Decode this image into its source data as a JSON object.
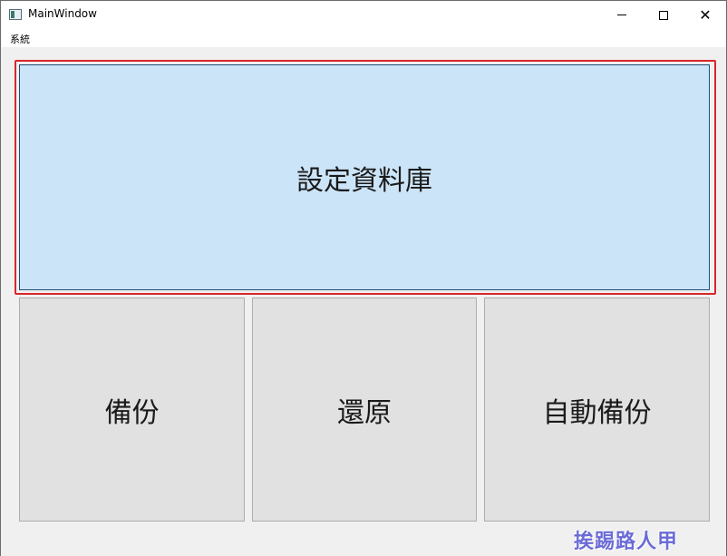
{
  "window": {
    "title": "MainWindow",
    "controls": {
      "minimize": "—",
      "maximize": "☐",
      "close": "✕"
    }
  },
  "menu": {
    "items": [
      {
        "label": "系統"
      }
    ]
  },
  "main": {
    "primary_button": "設定資料庫",
    "buttons": [
      {
        "label": "備份"
      },
      {
        "label": "還原"
      },
      {
        "label": "自動備份"
      }
    ]
  },
  "watermark": "挨踢路人甲",
  "colors": {
    "primary_bg": "#cce4f7",
    "primary_border": "#1f4f74",
    "focus": "#d9262c",
    "button_bg": "#e1e1e1"
  }
}
